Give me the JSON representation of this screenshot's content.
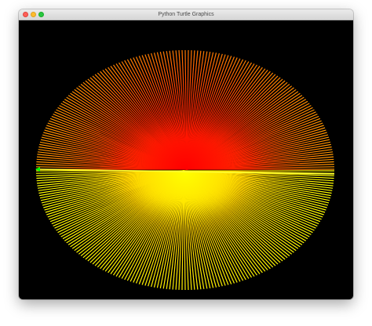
{
  "window": {
    "title": "Python Turtle Graphics"
  },
  "controls": {
    "close_icon": "close-icon",
    "minimize_icon": "minimize-icon",
    "zoom_icon": "zoom-icon"
  },
  "canvas": {
    "background_color": "#000000",
    "upper_fan": {
      "color_center": "#ff0000",
      "color_edge": "#ffff00",
      "ray_count": 150,
      "description_dir": "upper-left semicircle"
    },
    "lower_fan": {
      "color_center": "#ffff00",
      "color_edge": "#ffff00",
      "ray_count": 150,
      "description_dir": "lower-right semicircle"
    },
    "turtle_color": "#00ff00"
  }
}
